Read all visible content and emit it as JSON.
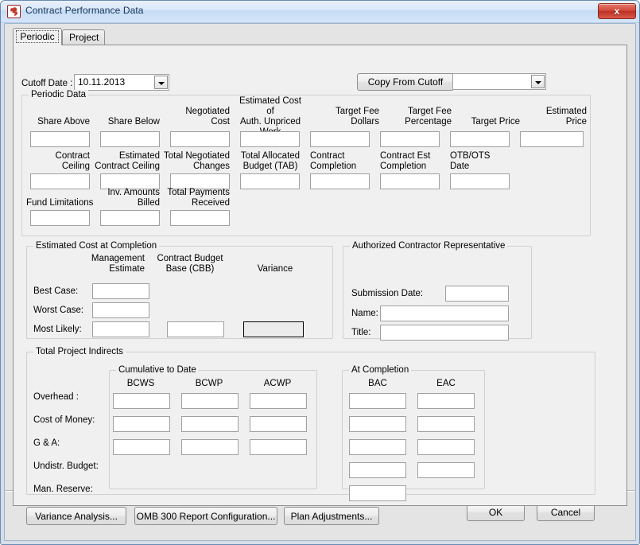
{
  "window": {
    "title": "Contract Performance Data",
    "icon": "app-pinwheel-icon",
    "close_label": "x",
    "accent_titlebar": "#c6dcf3",
    "accent_close": "#bb2f22"
  },
  "tabs": [
    {
      "label": "Periodic",
      "active": true
    },
    {
      "label": "Project",
      "active": false
    }
  ],
  "cutoff": {
    "label": "Cutoff Date :",
    "value": "10.11.2013",
    "placeholder": ""
  },
  "toolbar": {
    "copy_from_cutoff_label": "Copy From Cutoff",
    "copy_from_cutoff_mnemonic": "C",
    "cutoff_source_value": "",
    "cutoff_source_placeholder": ""
  },
  "periodic_data": {
    "title": "Periodic Data",
    "row1": [
      {
        "label": "Share Above",
        "align": "right",
        "value": ""
      },
      {
        "label": "Share Below",
        "align": "right",
        "value": ""
      },
      {
        "label": "Negotiated\nCost",
        "align": "right",
        "value": ""
      },
      {
        "label": "Estimated Cost of\nAuth. Unpriced\nWork",
        "align": "center",
        "value": ""
      },
      {
        "label": "Target Fee\nDollars",
        "align": "right",
        "value": ""
      },
      {
        "label": "Target Fee\nPercentage",
        "align": "right",
        "value": ""
      },
      {
        "label": "Target Price",
        "align": "right",
        "value": ""
      },
      {
        "label": "Estimated\nPrice",
        "align": "right",
        "value": ""
      }
    ],
    "row2": [
      {
        "label": "Contract\nCeiling",
        "align": "right",
        "value": ""
      },
      {
        "label": "Estimated\nContract Ceiling",
        "align": "right",
        "value": ""
      },
      {
        "label": "Total Negotiated\nChanges",
        "align": "right",
        "value": ""
      },
      {
        "label": "Total Allocated\nBudget (TAB)",
        "align": "center",
        "value": ""
      },
      {
        "label": "Contract\nCompletion",
        "align": "left",
        "value": ""
      },
      {
        "label": "Contract Est\nCompletion",
        "align": "left",
        "value": ""
      },
      {
        "label": "OTB/OTS\nDate",
        "align": "left",
        "value": ""
      }
    ],
    "row3": [
      {
        "label": "Fund Limitations",
        "align": "left",
        "value": ""
      },
      {
        "label": "Inv. Amounts\nBilled",
        "align": "right",
        "value": ""
      },
      {
        "label": "Total Payments\nReceived",
        "align": "right",
        "value": ""
      }
    ]
  },
  "estimated_cost_at_completion": {
    "title": "Estimated Cost at Completion",
    "columns": [
      "Management\nEstimate",
      "Contract Budget\nBase (CBB)",
      "Variance"
    ],
    "rows": [
      {
        "label": "Best Case:",
        "management": "",
        "cbb": null,
        "variance": null
      },
      {
        "label": "Worst Case:",
        "management": "",
        "cbb": null,
        "variance": null
      },
      {
        "label": "Most Likely:",
        "management": "",
        "cbb": "",
        "variance": ""
      }
    ]
  },
  "authorized_contractor_representative": {
    "title": "Authorized Contractor Representative",
    "fields": [
      {
        "label": "Submission Date:",
        "value": ""
      },
      {
        "label": "Name:",
        "value": ""
      },
      {
        "label": "Title:",
        "value": ""
      }
    ]
  },
  "total_project_indirects": {
    "title": "Total Project Indirects",
    "cumulative": {
      "title": "Cumulative to Date",
      "columns": [
        "BCWS",
        "BCWP",
        "ACWP"
      ]
    },
    "at_completion": {
      "title": "At Completion",
      "columns": [
        "BAC",
        "EAC"
      ]
    },
    "rows": [
      {
        "label": "Overhead :",
        "bcws": "",
        "bcwp": "",
        "acwp": "",
        "bac": "",
        "eac": ""
      },
      {
        "label": "Cost of Money:",
        "bcws": "",
        "bcwp": "",
        "acwp": "",
        "bac": "",
        "eac": ""
      },
      {
        "label": "G & A:",
        "bcws": "",
        "bcwp": "",
        "acwp": "",
        "bac": "",
        "eac": ""
      },
      {
        "label": "Undistr. Budget:",
        "bcws": null,
        "bcwp": null,
        "acwp": null,
        "bac": "",
        "eac": ""
      },
      {
        "label": "Man. Reserve:",
        "bcws": null,
        "bcwp": null,
        "acwp": null,
        "bac": "",
        "eac": null
      }
    ]
  },
  "action_buttons": [
    {
      "label": "Variance Analysis..."
    },
    {
      "label": "OMB 300 Report Configuration..."
    },
    {
      "label": "Plan Adjustments..."
    }
  ],
  "dialog_buttons": [
    {
      "label": "OK"
    },
    {
      "label": "Cancel"
    }
  ]
}
